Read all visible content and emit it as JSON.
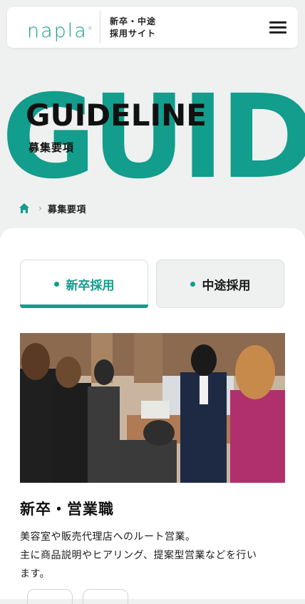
{
  "header": {
    "logo": "napla",
    "logo_mark": "®",
    "subtitle_line1": "新卒・中途",
    "subtitle_line2": "採用サイト",
    "menu_icon": "hamburger-menu-icon"
  },
  "hero": {
    "bg_text": "GUID",
    "title": "GUIDELINE",
    "subtitle": "募集要項"
  },
  "breadcrumb": {
    "home_icon": "home-icon",
    "current": "募集要項"
  },
  "tabs": [
    {
      "label": "新卒採用",
      "active": true
    },
    {
      "label": "中途採用",
      "active": false
    }
  ],
  "job": {
    "title": "新卒・営業職",
    "desc_line1": "美容室や販売代理店へのルート営業。",
    "desc_line2": "主に商品説明やヒアリング、提案型営業などを行い",
    "desc_line3": "ます。"
  },
  "colors": {
    "accent": "#129d8c",
    "background": "#eef1f0"
  }
}
